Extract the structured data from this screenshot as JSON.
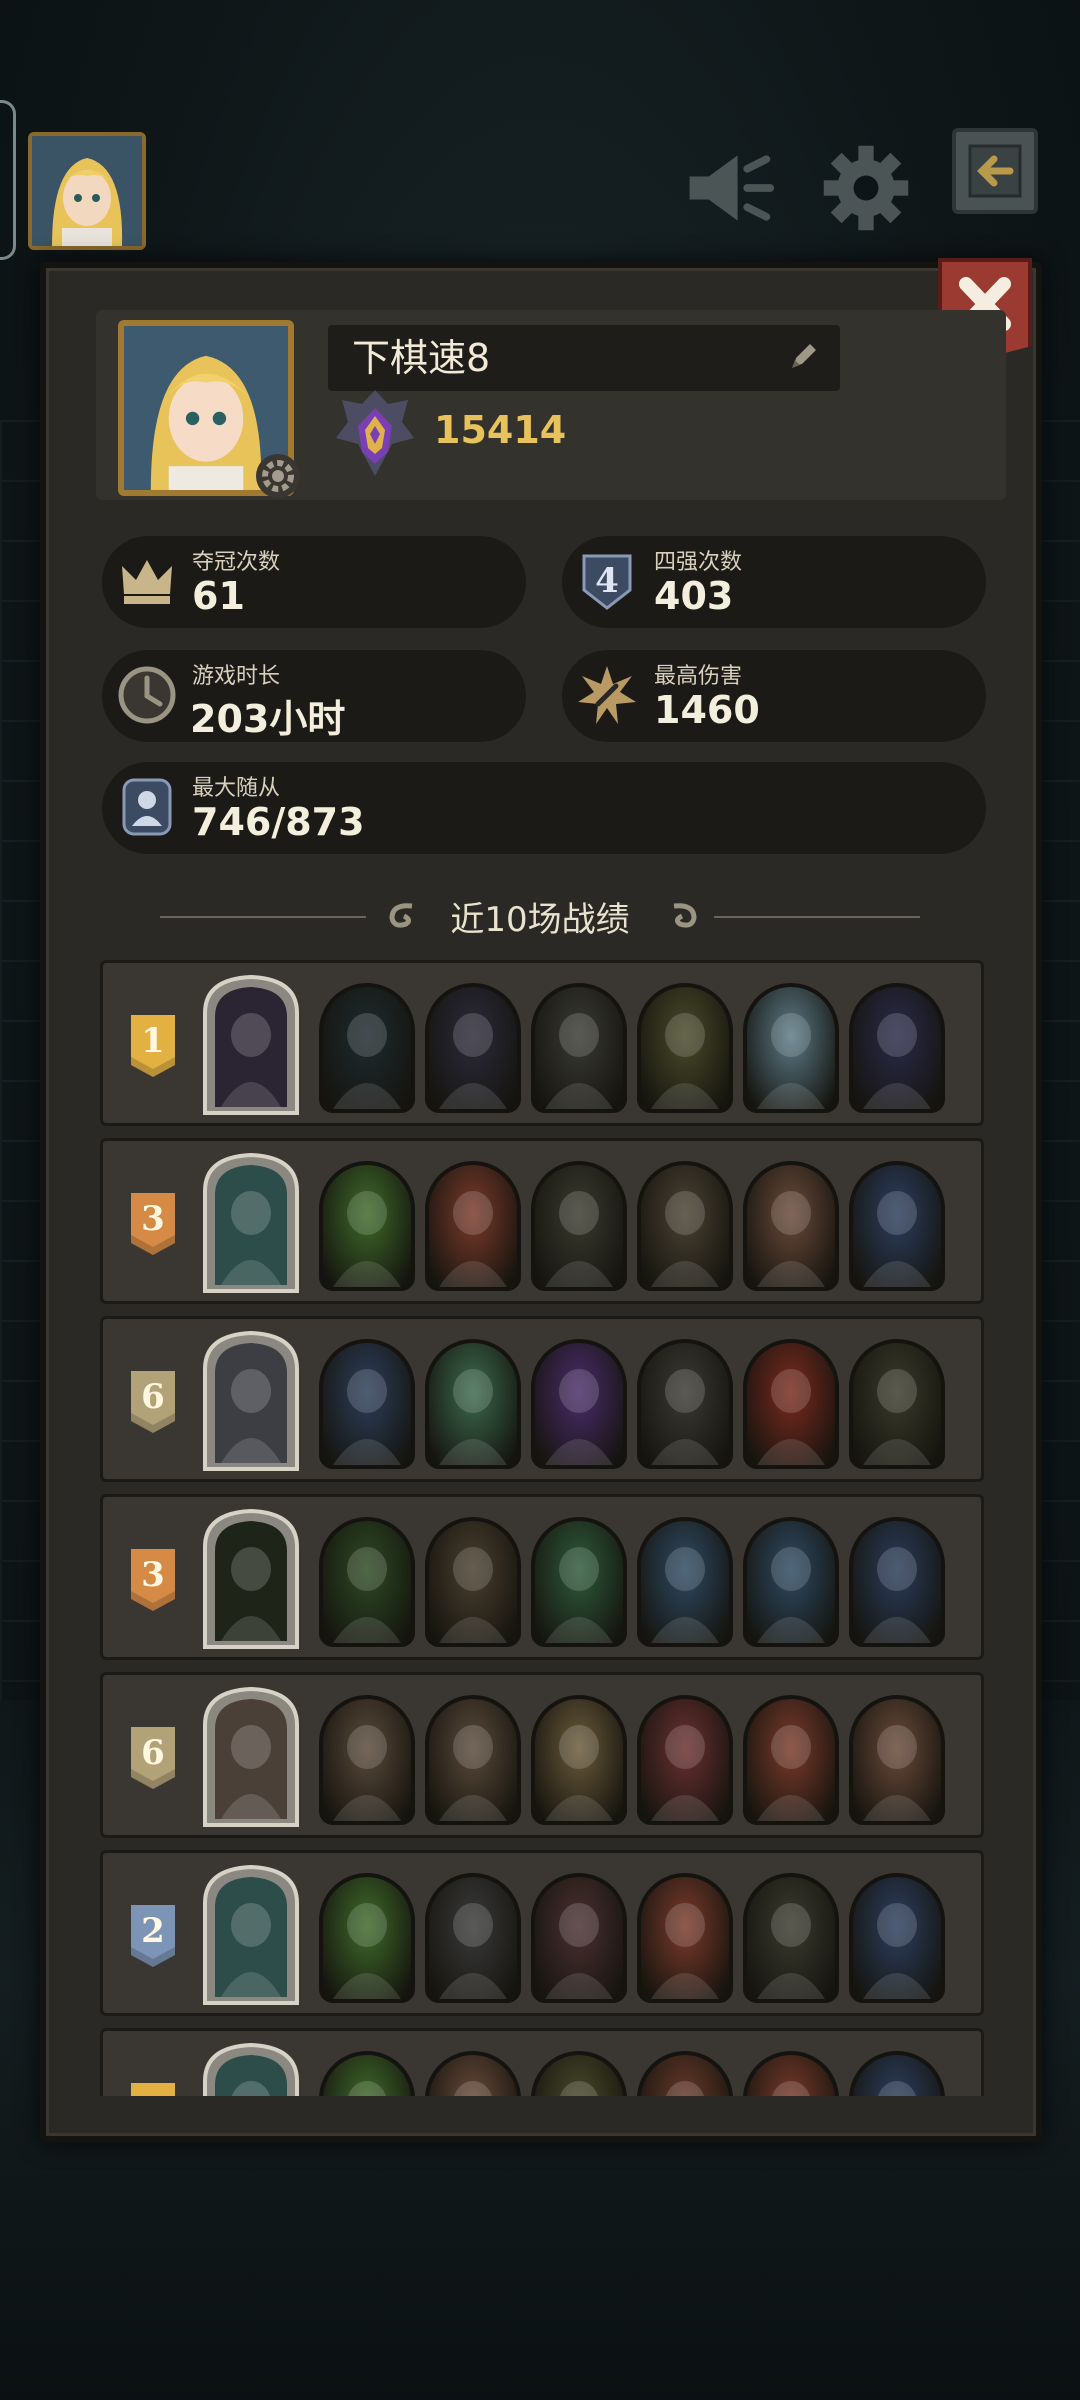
{
  "player": {
    "name": "下棋速8",
    "score": "15414"
  },
  "stats": {
    "championships": {
      "label": "夺冠次数",
      "value": "61"
    },
    "top4": {
      "label": "四强次数",
      "value": "403",
      "badge": "4"
    },
    "playtime": {
      "label": "游戏时长",
      "value": "203小时"
    },
    "max_damage": {
      "label": "最高伤害",
      "value": "1460"
    },
    "max_units": {
      "label": "最大随从",
      "value": "746/873"
    }
  },
  "section_title": "近10场战绩",
  "matches": [
    {
      "place": "1",
      "badge_color": "#e2b142",
      "hero_color": "#2a2433",
      "units": [
        "#1e2a2e",
        "#2c2a3a",
        "#3a3a34",
        "#4a4a2a",
        "#5c7a86",
        "#2a2a4a"
      ]
    },
    {
      "place": "3",
      "badge_color": "#d58a46",
      "hero_color": "#2c4d4a",
      "units": [
        "#3f6a2a",
        "#7a3a2a",
        "#3a3a2e",
        "#4a4232",
        "#6a4a3a",
        "#2c3e5e"
      ]
    },
    {
      "place": "6",
      "badge_color": "#b2a278",
      "hero_color": "#3c3e44",
      "units": [
        "#2c3e5a",
        "#3c6a4c",
        "#4a2c6a",
        "#3a3a32",
        "#7a2a1e",
        "#3a3a2a"
      ]
    },
    {
      "place": "3",
      "badge_color": "#d58a46",
      "hero_color": "#1e2418",
      "units": [
        "#2e4a24",
        "#4a3e2e",
        "#2e5a3a",
        "#2e4a62",
        "#2e4a62",
        "#2a3c5a"
      ]
    },
    {
      "place": "6",
      "badge_color": "#b2a278",
      "hero_color": "#4a4038",
      "units": [
        "#5a4a3a",
        "#5a4a3a",
        "#6a5a3a",
        "#6a3030",
        "#7a3a2a",
        "#6a4a3a"
      ]
    },
    {
      "place": "2",
      "badge_color": "#7c94b6",
      "hero_color": "#2c4d4a",
      "units": [
        "#3f6a2a",
        "#3a3a3a",
        "#4a3030",
        "#7a3a2a",
        "#3a3a2e",
        "#2c3e5e"
      ]
    },
    {
      "place": "",
      "badge_color": "#e2b142",
      "hero_color": "#2c4d4a",
      "units": [
        "#3f6a2a",
        "#6a4a3a",
        "#4a4a2a",
        "#6a3a2a",
        "#7a3a2a",
        "#2c3e5e"
      ]
    }
  ],
  "colors": {
    "panel": "#2b2925",
    "gold_text": "#e8c25a",
    "close_button": "#9a3a30"
  },
  "icons": [
    "sound-icon",
    "gear-icon",
    "back-arrow-icon",
    "close-icon",
    "edit-pencil-icon",
    "crown-icon",
    "top4-shield-icon",
    "clock-icon",
    "damage-burst-icon",
    "unit-portrait-icon"
  ]
}
